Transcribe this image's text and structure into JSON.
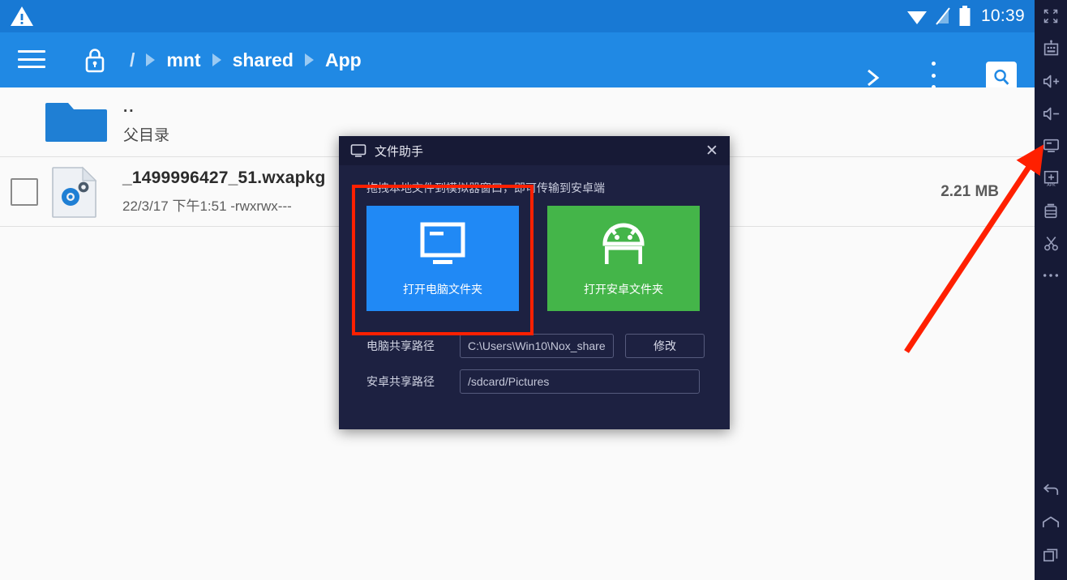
{
  "status_bar": {
    "warning_icon": "warning-triangle-icon",
    "wifi_icon": "wifi-icon",
    "signal_icon": "signal-off-icon",
    "battery_icon": "battery-icon",
    "time": "10:39"
  },
  "toolbar": {
    "menu_icon": "hamburger-menu-icon",
    "lock_icon": "lock-icon",
    "breadcrumb": [
      {
        "label": "/",
        "root": true
      },
      {
        "label": "mnt",
        "root": false
      },
      {
        "label": "shared",
        "root": false
      },
      {
        "label": "App",
        "root": false
      }
    ],
    "next_icon": "chevron-right-icon",
    "overflow_icon": "more-vertical-icon",
    "search_icon": "search-icon"
  },
  "file_list": {
    "parent_row": {
      "name": "..",
      "subtitle": "父目录",
      "icon": "folder-icon"
    },
    "files": [
      {
        "name": "_1499996427_51.wxapkg",
        "meta": "22/3/17 下午1:51   -rwxrwx---",
        "size": "2.21 MB",
        "icon": "file-settings-icon",
        "checked": false
      }
    ]
  },
  "dialog": {
    "title": "文件助手",
    "title_icon": "monitor-icon",
    "close_icon": "close-icon",
    "hint": "拖拽本地文件到模拟器窗口，即可传输到安卓端",
    "tiles": [
      {
        "label": "打开电脑文件夹",
        "icon": "monitor-icon",
        "color": "#2089f5"
      },
      {
        "label": "打开安卓文件夹",
        "icon": "android-robot-icon",
        "color": "#44b549"
      }
    ],
    "paths": [
      {
        "label": "电脑共享路径",
        "value": "C:\\Users\\Win10\\Nox_share",
        "button": "修改"
      },
      {
        "label": "安卓共享路径",
        "value": "/sdcard/Pictures"
      }
    ]
  },
  "sidebar": {
    "top_items": [
      {
        "icon": "fullscreen-icon"
      },
      {
        "icon": "robot-macro-icon"
      },
      {
        "icon": "volume-up-icon"
      },
      {
        "icon": "volume-down-icon"
      },
      {
        "icon": "shared-folder-monitor-icon"
      },
      {
        "icon": "install-apk-icon"
      },
      {
        "icon": "multi-instance-icon"
      },
      {
        "icon": "screenshot-scissors-icon"
      },
      {
        "icon": "more-horizontal-icon"
      }
    ],
    "bottom_items": [
      {
        "icon": "back-icon"
      },
      {
        "icon": "home-icon"
      },
      {
        "icon": "recents-icon"
      }
    ]
  },
  "annotations": {
    "highlight_color": "#ff2000",
    "rect_target": "打开电脑文件夹",
    "arrow_target": "shared-folder-monitor-icon"
  }
}
